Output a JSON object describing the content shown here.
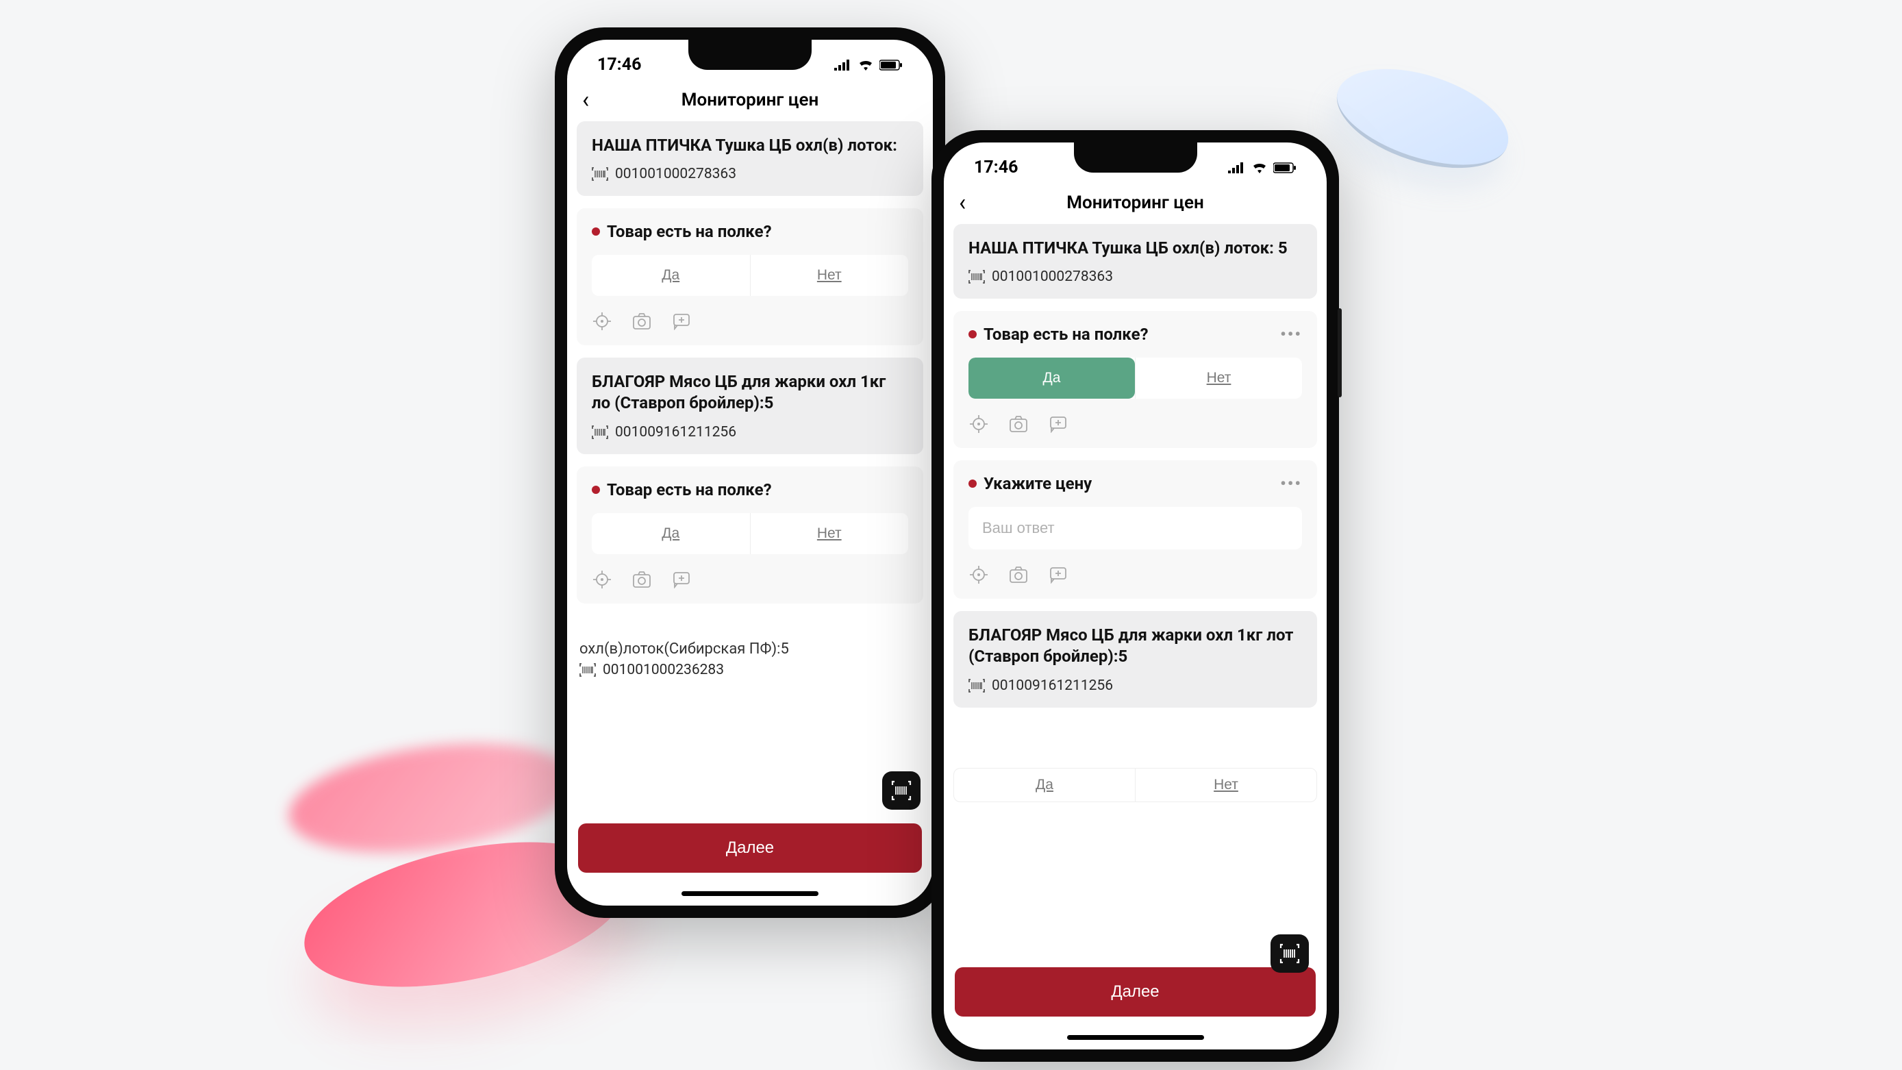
{
  "status": {
    "time": "17:46"
  },
  "nav": {
    "title": "Мониторинг цен"
  },
  "labels": {
    "next": "Далее",
    "yes": "Да",
    "no": "Нет"
  },
  "questions": {
    "on_shelf": "Товар есть на полке?",
    "price": "Укажите цену",
    "answer_placeholder": "Ваш ответ"
  },
  "products": {
    "p1": {
      "title": "НАША ПТИЧКА Тушка ЦБ охл(в) лоток: 5",
      "title_truncated": "НАША ПТИЧКА Тушка ЦБ охл(в) лоток:",
      "barcode": "001001000278363"
    },
    "p2": {
      "title": "БЛАГОЯР Мясо ЦБ для жарки охл 1кг лот (Ставроп бройлер):5",
      "title_truncated": "БЛАГОЯР Мясо ЦБ для жарки охл 1кг ло (Ставроп бройлер):5",
      "barcode": "001009161211256"
    },
    "p3": {
      "truncated_text": "охл(в)лоток(Сибирская ПФ):5",
      "barcode": "001001000236283"
    }
  }
}
